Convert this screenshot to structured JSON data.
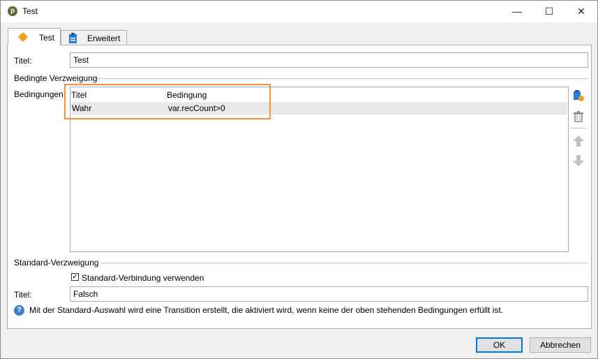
{
  "window": {
    "title": "Test",
    "app_icon": "p",
    "minimize_icon": "—",
    "maximize_icon": "☐",
    "close_icon": "✕"
  },
  "tabs": [
    {
      "label": "Test",
      "icon": "diamond-icon",
      "selected": true
    },
    {
      "label": "Erweitert",
      "icon": "clipboard-icon",
      "selected": false
    }
  ],
  "form": {
    "title_label": "Titel:",
    "title_value": "Test",
    "conditional_section": "Bedingte Verzweigung",
    "conditions_label": "Bedingungen:",
    "table": {
      "columns": [
        "Titel",
        "Bedingung"
      ],
      "rows": [
        {
          "titel": "Wahr",
          "bedingung": "var.recCount>0"
        }
      ]
    },
    "default_section": "Standard-Verzweigung",
    "use_default_label": "Standard-Verbindung verwenden",
    "use_default_checked": true,
    "default_title_label": "Titel:",
    "default_title_value": "Falsch",
    "info_text": "Mit der Standard-Auswahl wird eine Transition erstellt, die aktiviert wird, wenn keine der oben stehenden Bedingungen erfüllt ist."
  },
  "side_toolbar": [
    "add-icon",
    "delete-icon",
    "move-up-icon",
    "move-down-icon"
  ],
  "buttons": {
    "ok": "OK",
    "cancel": "Abbrechen"
  },
  "colors": {
    "highlight": "#f0923a",
    "accent": "#0078d7"
  }
}
